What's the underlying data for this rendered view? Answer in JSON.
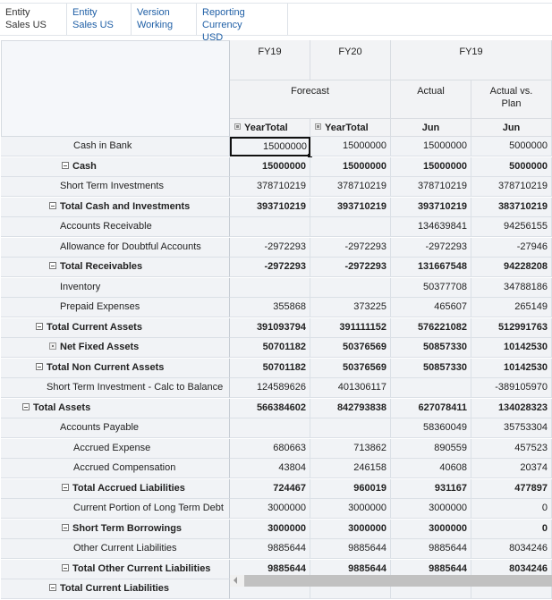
{
  "pov": [
    {
      "label": "Entity",
      "value": "Sales US",
      "link": false
    },
    {
      "label": "Entity",
      "value": "Sales US",
      "link": true
    },
    {
      "label": "Version",
      "value": "Working",
      "link": true
    },
    {
      "label": "Reporting Currency",
      "value": "USD",
      "link": true
    }
  ],
  "columns": {
    "years": [
      "FY19",
      "FY20",
      "FY19"
    ],
    "scenarios": [
      "Forecast",
      "Actual",
      "Actual vs. Plan"
    ],
    "periods": [
      "YearTotal",
      "YearTotal",
      "Jun",
      "Jun"
    ]
  },
  "rows": [
    {
      "label": "Cash in Bank",
      "indent": 4,
      "bold": false,
      "toggle": "none",
      "values": [
        "15000000",
        "15000000",
        "15000000",
        "5000000"
      ]
    },
    {
      "label": "Cash",
      "indent": 3,
      "bold": true,
      "toggle": "minus",
      "values": [
        "15000000",
        "15000000",
        "15000000",
        "5000000"
      ]
    },
    {
      "label": "Short Term Investments",
      "indent": 3,
      "bold": false,
      "toggle": "none",
      "values": [
        "378710219",
        "378710219",
        "378710219",
        "378710219"
      ]
    },
    {
      "label": "Total Cash and Investments",
      "indent": 2,
      "bold": true,
      "toggle": "minus",
      "values": [
        "393710219",
        "393710219",
        "393710219",
        "383710219"
      ]
    },
    {
      "label": "Accounts Receivable",
      "indent": 3,
      "bold": false,
      "toggle": "none",
      "values": [
        "",
        "",
        "134639841",
        "94256155"
      ]
    },
    {
      "label": "Allowance for Doubtful Accounts",
      "indent": 3,
      "bold": false,
      "toggle": "none",
      "values": [
        "-2972293",
        "-2972293",
        "-2972293",
        "-27946"
      ]
    },
    {
      "label": "Total Receivables",
      "indent": 2,
      "bold": true,
      "toggle": "minus",
      "values": [
        "-2972293",
        "-2972293",
        "131667548",
        "94228208"
      ]
    },
    {
      "label": "Inventory",
      "indent": 2,
      "bold": false,
      "toggle": "none",
      "values": [
        "",
        "",
        "50377708",
        "34788186"
      ]
    },
    {
      "label": "Prepaid Expenses",
      "indent": 2,
      "bold": false,
      "toggle": "none",
      "values": [
        "355868",
        "373225",
        "465607",
        "265149"
      ]
    },
    {
      "label": "Total Current Assets",
      "indent": 1,
      "bold": true,
      "toggle": "minus",
      "values": [
        "391093794",
        "391111152",
        "576221082",
        "512991763"
      ]
    },
    {
      "label": "Net Fixed Assets",
      "indent": 2,
      "bold": true,
      "toggle": "plus",
      "values": [
        "50701182",
        "50376569",
        "50857330",
        "10142530"
      ]
    },
    {
      "label": "Total Non Current Assets",
      "indent": 1,
      "bold": true,
      "toggle": "minus",
      "values": [
        "50701182",
        "50376569",
        "50857330",
        "10142530"
      ]
    },
    {
      "label": "Short Term Investment - Calc to Balance",
      "indent": 1,
      "bold": false,
      "toggle": "none",
      "values": [
        "124589626",
        "401306117",
        "",
        "-389105970"
      ]
    },
    {
      "label": "Total Assets",
      "indent": 0,
      "bold": true,
      "toggle": "minus",
      "values": [
        "566384602",
        "842793838",
        "627078411",
        "134028323"
      ]
    },
    {
      "label": "Accounts Payable",
      "indent": 3,
      "bold": false,
      "toggle": "none",
      "values": [
        "",
        "",
        "58360049",
        "35753304"
      ]
    },
    {
      "label": "Accrued Expense",
      "indent": 4,
      "bold": false,
      "toggle": "none",
      "values": [
        "680663",
        "713862",
        "890559",
        "457523"
      ]
    },
    {
      "label": "Accrued Compensation",
      "indent": 4,
      "bold": false,
      "toggle": "none",
      "values": [
        "43804",
        "246158",
        "40608",
        "20374"
      ]
    },
    {
      "label": "Total Accrued Liabilities",
      "indent": 3,
      "bold": true,
      "toggle": "minus",
      "values": [
        "724467",
        "960019",
        "931167",
        "477897"
      ]
    },
    {
      "label": "Current Portion of Long Term Debt",
      "indent": 4,
      "bold": false,
      "toggle": "none",
      "values": [
        "3000000",
        "3000000",
        "3000000",
        "0"
      ]
    },
    {
      "label": "Short Term Borrowings",
      "indent": 3,
      "bold": true,
      "toggle": "minus",
      "values": [
        "3000000",
        "3000000",
        "3000000",
        "0"
      ]
    },
    {
      "label": "Other Current Liabilities",
      "indent": 4,
      "bold": false,
      "toggle": "none",
      "values": [
        "9885644",
        "9885644",
        "9885644",
        "8034246"
      ]
    },
    {
      "label": "Total Other Current Liabilities",
      "indent": 3,
      "bold": true,
      "toggle": "minus",
      "values": [
        "9885644",
        "9885644",
        "9885644",
        "8034246"
      ]
    },
    {
      "label": "Total Current Liabilities",
      "indent": 2,
      "bold": true,
      "toggle": "minus",
      "values": [
        "",
        "",
        "",
        ""
      ]
    }
  ],
  "selected_cell": {
    "row": 0,
    "col": 0
  }
}
